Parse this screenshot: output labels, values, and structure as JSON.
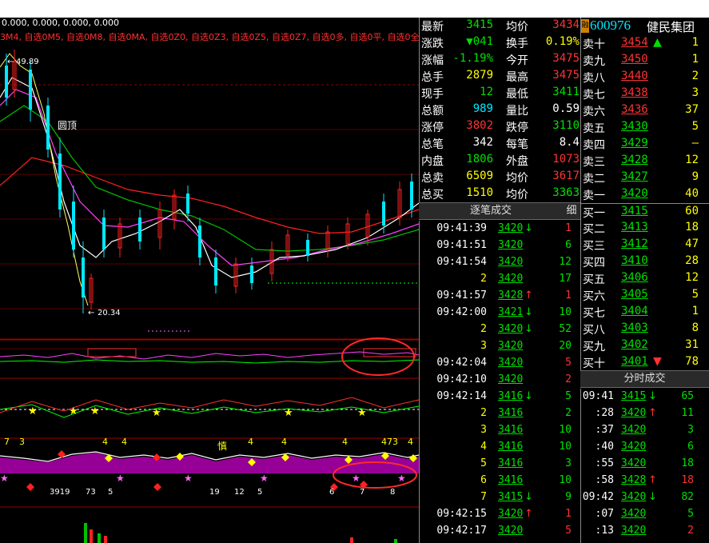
{
  "chart": {
    "header": "0.000, 0.000, 0.000, 0.000",
    "indicators": "3M4, 自选0M5, 自选0M8, 自选0MA, 自选0Z0, 自选0Z3, 自选0Z5, 自选0Z7, 自选0多, 自选0平, 自选0全, 自",
    "high_label": "49.89",
    "low_label": "20.34",
    "top_label": "圆顶",
    "mid_label": "慎"
  },
  "quote": {
    "rows": [
      {
        "l1": "最新",
        "v1": "3415",
        "l2": "均价",
        "v2": "3434",
        "c1": "green",
        "c2": "red"
      },
      {
        "l1": "涨跌",
        "v1": "▼041",
        "l2": "换手",
        "v2": "0.19%",
        "c1": "green",
        "c2": "yellow"
      },
      {
        "l1": "涨幅",
        "v1": "-1.19%",
        "l2": "今开",
        "v2": "3475",
        "c1": "green",
        "c2": "red"
      },
      {
        "l1": "总手",
        "v1": "2879",
        "l2": "最高",
        "v2": "3475",
        "c1": "yellow",
        "c2": "red"
      },
      {
        "l1": "现手",
        "v1": "12",
        "l2": "最低",
        "v2": "3411",
        "c1": "green",
        "c2": "green"
      },
      {
        "l1": "总额",
        "v1": "989",
        "l2": "量比",
        "v2": "0.59",
        "c1": "cyan",
        "c2": "white"
      },
      {
        "l1": "涨停",
        "v1": "3802",
        "l2": "跌停",
        "v2": "3110",
        "c1": "red",
        "c2": "green"
      },
      {
        "l1": "总笔",
        "v1": "342",
        "l2": "每笔",
        "v2": "8.4",
        "c1": "white",
        "c2": "white"
      },
      {
        "l1": "内盘",
        "v1": "1806",
        "l2": "外盘",
        "v2": "1073",
        "c1": "green",
        "c2": "red"
      },
      {
        "l1": "总卖",
        "v1": "6509",
        "l2": "均价",
        "v2": "3617",
        "c1": "yellow",
        "c2": "red"
      },
      {
        "l1": "总买",
        "v1": "1510",
        "l2": "均价",
        "v2": "3363",
        "c1": "yellow",
        "c2": "green"
      }
    ]
  },
  "book": {
    "badge": "融",
    "code": "600976",
    "name": "健民集团",
    "rows": [
      {
        "label": "卖十",
        "price": "3454",
        "arrow": "▲",
        "vol": "1",
        "pc": "red",
        "ac": "green"
      },
      {
        "label": "卖九",
        "price": "3450",
        "arrow": "",
        "vol": "1",
        "pc": "red"
      },
      {
        "label": "卖八",
        "price": "3440",
        "arrow": "",
        "vol": "2",
        "pc": "red"
      },
      {
        "label": "卖七",
        "price": "3438",
        "arrow": "",
        "vol": "3",
        "pc": "red"
      },
      {
        "label": "卖六",
        "price": "3436",
        "arrow": "",
        "vol": "37",
        "pc": "red"
      },
      {
        "label": "卖五",
        "price": "3430",
        "arrow": "",
        "vol": "5",
        "pc": "green"
      },
      {
        "label": "卖四",
        "price": "3429",
        "arrow": "",
        "vol": "—",
        "pc": "green"
      },
      {
        "label": "卖三",
        "price": "3428",
        "arrow": "",
        "vol": "12",
        "pc": "green"
      },
      {
        "label": "卖二",
        "price": "3427",
        "arrow": "",
        "vol": "9",
        "pc": "green"
      },
      {
        "label": "卖一",
        "price": "3420",
        "arrow": "",
        "vol": "40",
        "pc": "green"
      },
      {
        "label": "买一",
        "price": "3415",
        "arrow": "",
        "vol": "60",
        "pc": "green"
      },
      {
        "label": "买二",
        "price": "3413",
        "arrow": "",
        "vol": "18",
        "pc": "green"
      },
      {
        "label": "买三",
        "price": "3412",
        "arrow": "",
        "vol": "47",
        "pc": "green"
      },
      {
        "label": "买四",
        "price": "3410",
        "arrow": "",
        "vol": "28",
        "pc": "green"
      },
      {
        "label": "买五",
        "price": "3406",
        "arrow": "",
        "vol": "12",
        "pc": "green"
      },
      {
        "label": "买六",
        "price": "3405",
        "arrow": "",
        "vol": "5",
        "pc": "green"
      },
      {
        "label": "买七",
        "price": "3404",
        "arrow": "",
        "vol": "1",
        "pc": "green"
      },
      {
        "label": "买八",
        "price": "3403",
        "arrow": "",
        "vol": "8",
        "pc": "green"
      },
      {
        "label": "买九",
        "price": "3402",
        "arrow": "",
        "vol": "31",
        "pc": "green"
      },
      {
        "label": "买十",
        "price": "3401",
        "arrow": "▼",
        "vol": "78",
        "pc": "green",
        "ac": "red"
      }
    ]
  },
  "ticks_tab": {
    "label": "逐笔成交",
    "side": "细"
  },
  "ticks": [
    {
      "time": "09:41:39",
      "price": "3420",
      "arrow": "↓",
      "ac": "green",
      "vol": "1",
      "vc": "red"
    },
    {
      "time": "09:41:51",
      "price": "3420",
      "arrow": "",
      "vol": "6",
      "vc": "green"
    },
    {
      "time": "09:41:54",
      "price": "3420",
      "arrow": "",
      "vol": "12",
      "vc": "green"
    },
    {
      "time": "2",
      "price": "3420",
      "arrow": "",
      "vol": "17",
      "vc": "green"
    },
    {
      "time": "09:41:57",
      "price": "3428",
      "arrow": "↑",
      "ac": "red",
      "vol": "1",
      "vc": "red"
    },
    {
      "time": "09:42:00",
      "price": "3421",
      "arrow": "↓",
      "ac": "green",
      "vol": "10",
      "vc": "green"
    },
    {
      "time": "2",
      "price": "3420",
      "arrow": "↓",
      "ac": "green",
      "vol": "52",
      "vc": "green"
    },
    {
      "time": "3",
      "price": "3420",
      "arrow": "",
      "vol": "20",
      "vc": "green"
    },
    {
      "time": "09:42:04",
      "price": "3420",
      "arrow": "",
      "vol": "5",
      "vc": "red"
    },
    {
      "time": "09:42:10",
      "price": "3420",
      "arrow": "",
      "vol": "2",
      "vc": "red"
    },
    {
      "time": "09:42:14",
      "price": "3416",
      "arrow": "↓",
      "ac": "green",
      "vol": "5",
      "vc": "green"
    },
    {
      "time": "2",
      "price": "3416",
      "arrow": "",
      "vol": "2",
      "vc": "green"
    },
    {
      "time": "3",
      "price": "3416",
      "arrow": "",
      "vol": "10",
      "vc": "green"
    },
    {
      "time": "4",
      "price": "3416",
      "arrow": "",
      "vol": "10",
      "vc": "green"
    },
    {
      "time": "5",
      "price": "3416",
      "arrow": "",
      "vol": "3",
      "vc": "green"
    },
    {
      "time": "6",
      "price": "3416",
      "arrow": "",
      "vol": "10",
      "vc": "green"
    },
    {
      "time": "7",
      "price": "3415",
      "arrow": "↓",
      "ac": "green",
      "vol": "9",
      "vc": "green"
    },
    {
      "time": "09:42:15",
      "price": "3420",
      "arrow": "↑",
      "ac": "red",
      "vol": "1",
      "vc": "red"
    },
    {
      "time": "09:42:17",
      "price": "3420",
      "arrow": "",
      "vol": "5",
      "vc": "red"
    }
  ],
  "minute_tab": {
    "label": "分时成交"
  },
  "minute": [
    {
      "time": "09:41",
      "price": "3415",
      "arrow": "↓",
      "ac": "green",
      "vol": "65",
      "vc": "green"
    },
    {
      "time": ":28",
      "price": "3420",
      "arrow": "↑",
      "ac": "red",
      "vol": "11",
      "vc": "green"
    },
    {
      "time": ":37",
      "price": "3420",
      "arrow": "",
      "vol": "3",
      "vc": "green"
    },
    {
      "time": ":40",
      "price": "3420",
      "arrow": "",
      "vol": "6",
      "vc": "green"
    },
    {
      "time": ":55",
      "price": "3420",
      "arrow": "",
      "vol": "18",
      "vc": "green"
    },
    {
      "time": ":58",
      "price": "3428",
      "arrow": "↑",
      "ac": "red",
      "vol": "18",
      "vc": "red"
    },
    {
      "time": "09:42",
      "price": "3420",
      "arrow": "↓",
      "ac": "green",
      "vol": "82",
      "vc": "green"
    },
    {
      "time": ":07",
      "price": "3420",
      "arrow": "",
      "vol": "5",
      "vc": "green"
    },
    {
      "time": ":13",
      "price": "3420",
      "arrow": "",
      "vol": "2",
      "vc": "red"
    }
  ],
  "colors": {
    "up": "#ff3232",
    "down": "#00e000",
    "highlight": "#ffff00",
    "bg": "#000000"
  }
}
